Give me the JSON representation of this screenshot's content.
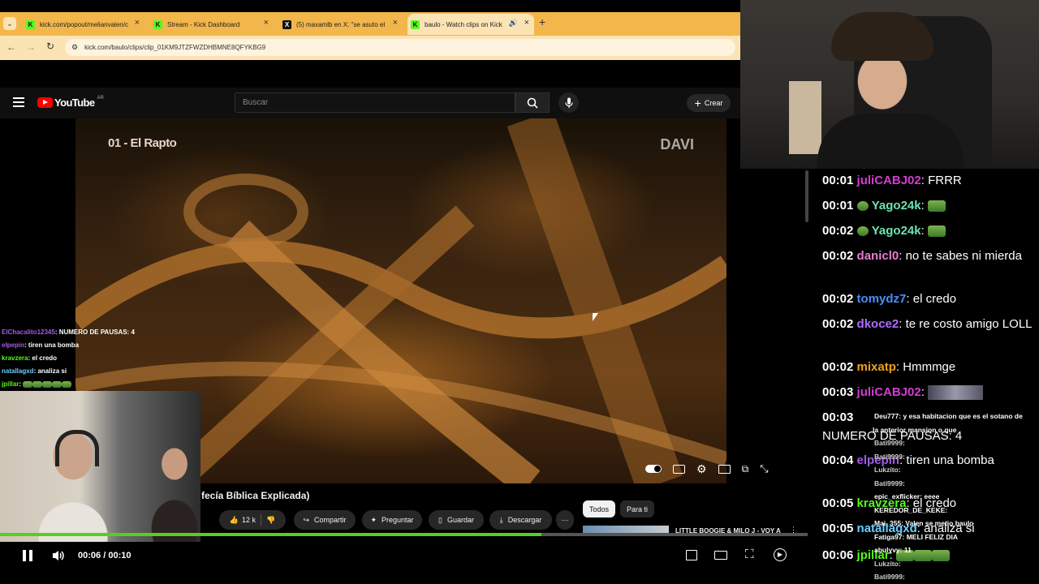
{
  "browser": {
    "tabs": [
      {
        "label": "kick.com/popout/melianvalen/c",
        "favicon": "K",
        "favcolor": "#53fc18"
      },
      {
        "label": "Stream - Kick Dashboard",
        "favicon": "K",
        "favcolor": "#53fc18"
      },
      {
        "label": "(5) maxamlb en X: \"se asuto el",
        "favicon": "X",
        "favcolor": "#ffffff"
      },
      {
        "label": "baulo - Watch clips on Kick",
        "favicon": "K",
        "favcolor": "#53fc18"
      }
    ],
    "url": "kick.com/baulo/clips/clip_01KM9JTZFWZDHBMNE8QFYKBG9"
  },
  "youtube": {
    "logo": "YouTube",
    "region": "AR",
    "search_placeholder": "Buscar",
    "create_label": "Crear",
    "video_overlay_title": "01 - El Rapto",
    "watermark": "DAVI",
    "video_title": "fecía Bíblica Explicada)",
    "likes": "12 k",
    "share_label": "Compartir",
    "ask_label": "Preguntar",
    "save_label": "Guardar",
    "download_label": "Descargar",
    "chip_all": "Todos",
    "chip_foryou": "Para ti",
    "suggestion": "LITTLE BOOGIE & MILO J - VOY A DISPARARME (VIDEOCLIP"
  },
  "player": {
    "current_time": "00:06",
    "separator": "/",
    "duration": "00:10",
    "progress": 0.67
  },
  "overlay_chat": [
    {
      "user": "ElChacalito12345",
      "color": "#a35be8",
      "text": ": NUMERO DE PAUSAS: 4"
    },
    {
      "user": "elpepin",
      "color": "#a35be8",
      "text": ": tiren una bomba"
    },
    {
      "user": "kravzera",
      "color": "#53fc18",
      "text": ": el credo"
    },
    {
      "user": "natallagxd",
      "color": "#6ad0ff",
      "text": ": analiza si"
    },
    {
      "user": "jpillar",
      "color": "#53fc18",
      "text": ":"
    }
  ],
  "chat": [
    {
      "time": "00:01",
      "user": "juliCABJ02",
      "color": "#d23cd2",
      "text": ": FRRR"
    },
    {
      "time": "00:01",
      "user": "Yago24k",
      "color": "#6de3b0",
      "text": ":"
    },
    {
      "time": "00:02",
      "user": "Yago24k",
      "color": "#6de3b0",
      "text": ":"
    },
    {
      "time": "00:02",
      "user": "danicl0",
      "color": "#e67cd1",
      "text": ": no te sabes ni mierda"
    },
    {
      "time": "00:02",
      "user": "tomydz7",
      "color": "#4a8ff7",
      "text": ": el credo"
    },
    {
      "time": "00:02",
      "user": "dkoce2",
      "color": "#b26bff",
      "text": ": te re costo amigo LOLL"
    },
    {
      "time": "00:02",
      "user": "mixatp",
      "color": "#f0a11f",
      "text": ": Hmmmge"
    },
    {
      "time": "00:03",
      "user": "juliCABJ02",
      "color": "#d23cd2",
      "text": ":"
    },
    {
      "time": "00:03",
      "user": "",
      "color": "#ffffff",
      "text": "NUMERO DE PAUSAS: 4"
    },
    {
      "time": "00:04",
      "user": "elpepin",
      "color": "#a35be8",
      "text": ": tiren una bomba"
    },
    {
      "time": "00:05",
      "user": "kravzera",
      "color": "#53fc18",
      "text": ": el credo"
    },
    {
      "time": "00:05",
      "user": "natallagxd",
      "color": "#6ad0ff",
      "text": ": analiza si"
    },
    {
      "time": "00:06",
      "user": "jpillar",
      "color": "#53fc18",
      "text": ":"
    }
  ],
  "mini_chat": [
    {
      "user": "Deu777",
      "color": "#ffffff",
      "text": ": y esa habitacion que es el sotano de"
    },
    {
      "user": "",
      "color": "#ffffff",
      "text": "la anterior mansion o que"
    },
    {
      "user": "Bati9999",
      "color": "#cfcfcf",
      "text": ":"
    },
    {
      "user": "Bati9999",
      "color": "#cfcfcf",
      "text": ":"
    },
    {
      "user": "Lukzito",
      "color": "#cfcfcf",
      "text": ":"
    },
    {
      "user": "Bati9999",
      "color": "#cfcfcf",
      "text": ":"
    },
    {
      "user": "epic_exflicker",
      "color": "#ffffff",
      "text": ": eeee"
    },
    {
      "user": "KEREDOR_DE_KEKE",
      "color": "#ffffff",
      "text": ":"
    },
    {
      "user": "Mai_355",
      "color": "#ffffff",
      "text": ": Valen se metio baulo"
    },
    {
      "user": "Fatiga97",
      "color": "#ffffff",
      "text": ": MELI FELIZ DIA"
    },
    {
      "user": "abulyvy",
      "color": "#ffffff",
      "text": ": 11"
    },
    {
      "user": "Lukzito",
      "color": "#cfcfcf",
      "text": ":"
    },
    {
      "user": "Bati9999",
      "color": "#cfcfcf",
      "text": ":"
    }
  ]
}
